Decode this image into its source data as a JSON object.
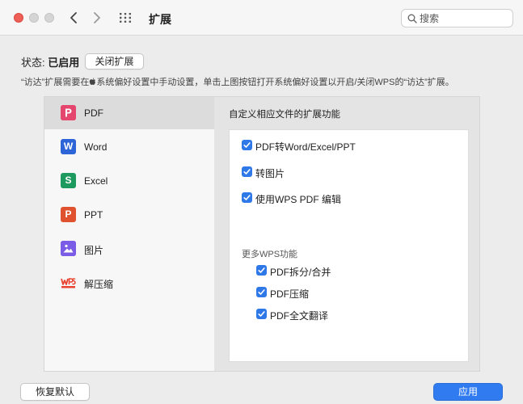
{
  "window": {
    "title": "扩展",
    "search_placeholder": "搜索"
  },
  "status": {
    "prefix": "状态: ",
    "value": "已启用",
    "toggle_button": "关闭扩展"
  },
  "hint": {
    "before": "“访达”扩展需要在",
    "after": "系统偏好设置中手动设置，单击上图按钮打开系统偏好设置以开启/关闭WPS的“访达”扩展。"
  },
  "sidebar": {
    "items": [
      {
        "label": "PDF",
        "icon": "pdf-icon",
        "glyph": "P",
        "color": "#e5466e"
      },
      {
        "label": "Word",
        "icon": "word-icon",
        "glyph": "W",
        "color": "#2d64d8"
      },
      {
        "label": "Excel",
        "icon": "excel-icon",
        "glyph": "S",
        "color": "#1f9a5f"
      },
      {
        "label": "PPT",
        "icon": "ppt-icon",
        "glyph": "P",
        "color": "#e0522f"
      },
      {
        "label": "图片",
        "icon": "image-icon",
        "glyph": "",
        "color": "#7b5ce6"
      },
      {
        "label": "解压缩",
        "icon": "wps-zip-icon",
        "glyph": "",
        "color": "#e8442f"
      }
    ],
    "active_index": 0
  },
  "content": {
    "title": "自定义相应文件的扩展功能",
    "options": [
      {
        "label": "PDF转Word/Excel/PPT",
        "checked": true
      },
      {
        "label": "转图片",
        "checked": true
      },
      {
        "label": "使用WPS PDF 编辑",
        "checked": true
      }
    ],
    "more_title": "更多WPS功能",
    "more_options": [
      {
        "label": "PDF拆分/合并",
        "checked": true
      },
      {
        "label": "PDF压缩",
        "checked": true
      },
      {
        "label": "PDF全文翻译",
        "checked": true
      }
    ]
  },
  "footer": {
    "reset_button": "恢复默认",
    "apply_button": "应用"
  },
  "colors": {
    "accent": "#2f7bef",
    "close": "#ee5f57"
  }
}
